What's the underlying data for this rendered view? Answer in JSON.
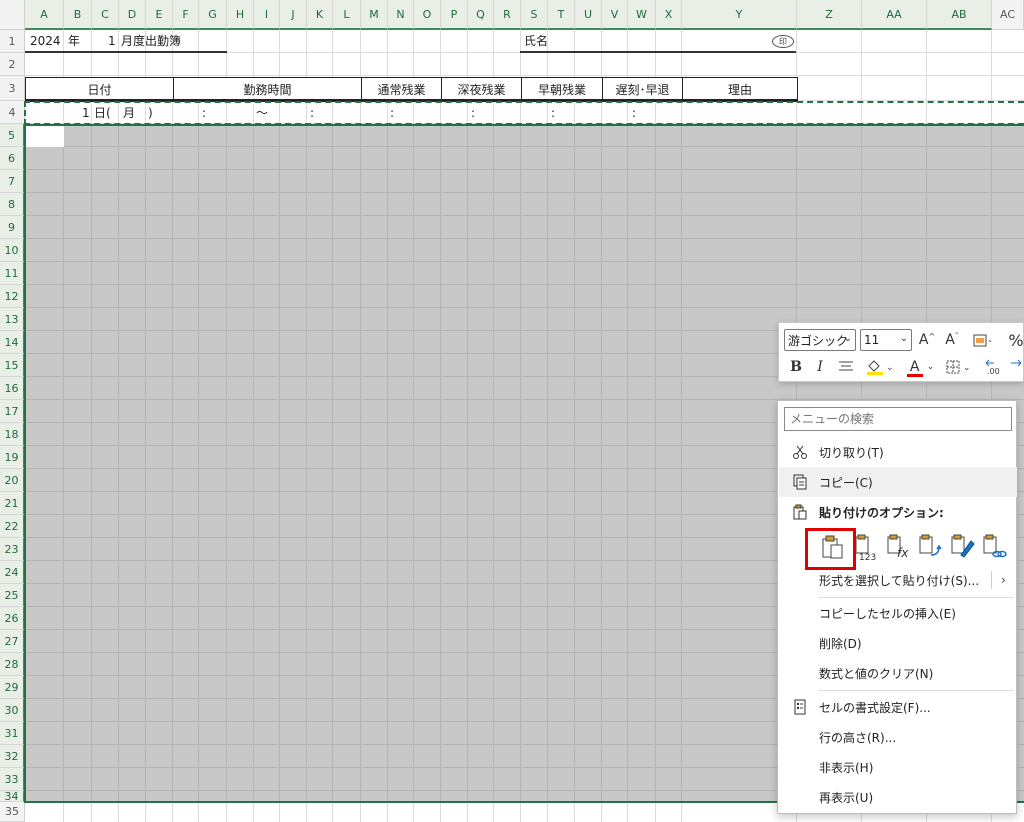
{
  "columns": [
    "A",
    "B",
    "C",
    "D",
    "E",
    "F",
    "G",
    "H",
    "I",
    "J",
    "K",
    "L",
    "M",
    "N",
    "O",
    "P",
    "Q",
    "R",
    "S",
    "T",
    "U",
    "V",
    "W",
    "X",
    "Y",
    "Z",
    "AA",
    "AB",
    "AC"
  ],
  "rows": [
    "1",
    "2",
    "3",
    "4",
    "5",
    "6",
    "7",
    "8",
    "9",
    "10",
    "11",
    "12",
    "13",
    "14",
    "15",
    "16",
    "17",
    "18",
    "19",
    "20",
    "21",
    "22",
    "23",
    "24",
    "25",
    "26",
    "27",
    "28",
    "29",
    "30",
    "31",
    "32",
    "33",
    "34",
    "35"
  ],
  "cells": {
    "a1_year": "2024",
    "b1_year_unit": "年",
    "c1_month": "1",
    "d1_title": "月度出勤簿",
    "s1_name_label": "氏名",
    "x1_seal": "印",
    "a4_day": "1",
    "c4_day_unit": "日(",
    "d4_weekday": "月",
    "e4_close": ")",
    "g4_colon": ":",
    "i4_tilde": "～",
    "k4_colon": ":",
    "n4_colon": ":",
    "q4_colon": ":",
    "t4_colon": ":",
    "w4_colon": ":"
  },
  "table_headers": [
    "日付",
    "勤務時間",
    "通常残業",
    "深夜残業",
    "早朝残業",
    "遅刻･早退",
    "理由"
  ],
  "mini_toolbar": {
    "font_name": "游ゴシック",
    "font_size": "11",
    "grow_font": "A",
    "shrink_font": "A",
    "percent": "%",
    "bold": "B",
    "italic": "I",
    "font_color": "A",
    "accent_yellow": "#ffe000",
    "accent_red": "#e00000"
  },
  "context_menu": {
    "search_placeholder": "メニューの検索",
    "cut": "切り取り(T)",
    "copy": "コピー(C)",
    "paste_options": "貼り付けのオプション:",
    "paste_values_badge": "123",
    "paste_special": "形式を選択して貼り付け(S)...",
    "insert_copied": "コピーしたセルの挿入(E)",
    "delete": "削除(D)",
    "clear_contents": "数式と値のクリア(N)",
    "format_cells": "セルの書式設定(F)...",
    "row_height": "行の高さ(R)...",
    "hide": "非表示(H)",
    "unhide": "再表示(U)",
    "highlight_color": "#e00000"
  }
}
